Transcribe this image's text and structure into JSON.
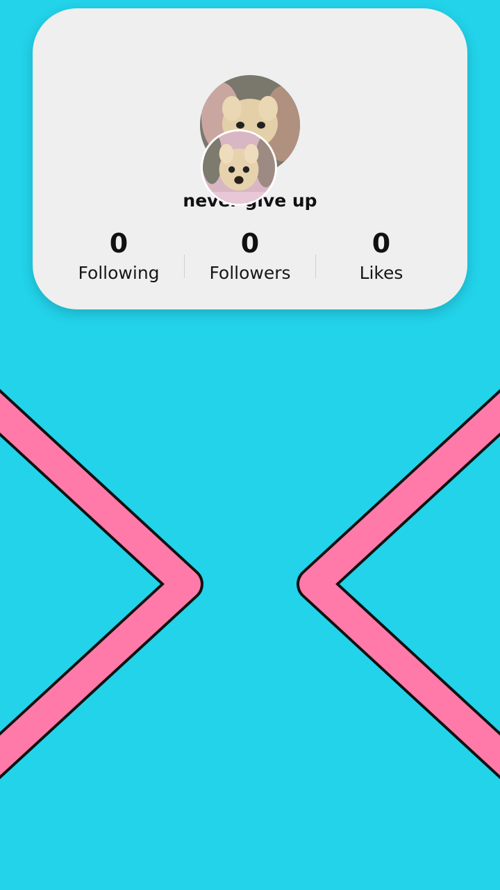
{
  "colors": {
    "background": "#22d3ea",
    "card": "#efeff0",
    "chevron_fill": "#ff7aa8",
    "chevron_outline": "#111111"
  },
  "profile": {
    "username": "never give up",
    "avatar_icon": "dog-avatar-icon"
  },
  "stats": [
    {
      "value": "0",
      "label": "Following"
    },
    {
      "value": "0",
      "label": "Followers"
    },
    {
      "value": "0",
      "label": "Likes"
    }
  ],
  "decorations": {
    "left_shape": "chevron-right",
    "right_shape": "chevron-left"
  }
}
